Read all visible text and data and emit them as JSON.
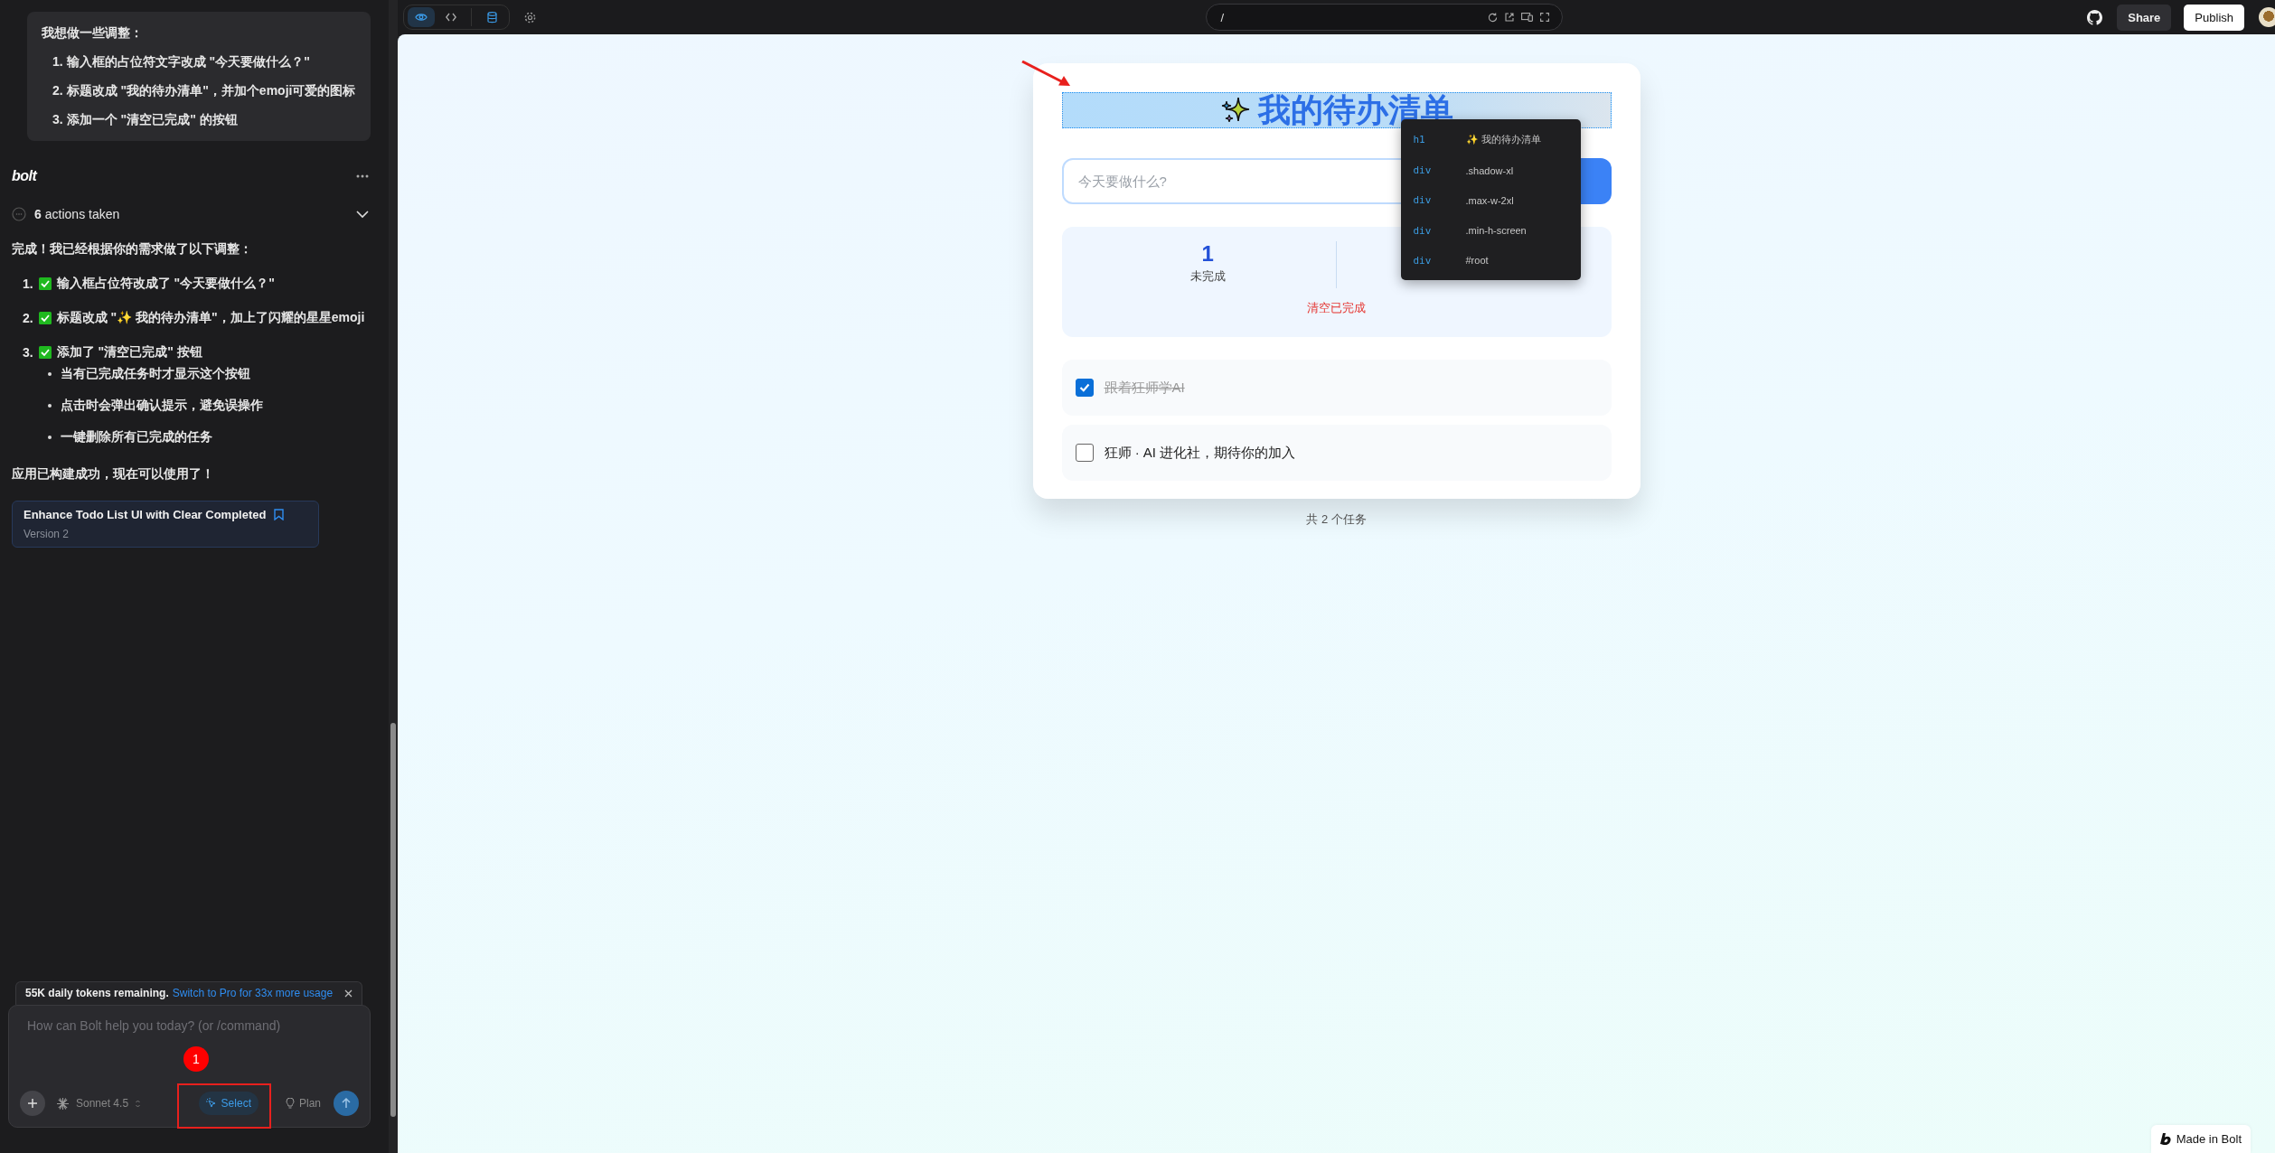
{
  "chat": {
    "user_message": {
      "intro": "我想做一些调整：",
      "items": [
        {
          "number": "1.",
          "text": "输入框的占位符文字改成 \"今天要做什么？\""
        },
        {
          "number": "2.",
          "text": "标题改成 \"我的待办清单\"，并加个emoji可爱的图标"
        },
        {
          "number": "3.",
          "text": "添加一个 \"清空已完成\" 的按钮"
        }
      ]
    },
    "assistant": {
      "name": "bolt",
      "actions": {
        "count": "6",
        "label": "actions taken",
        "expanded": false
      },
      "intro": "完成！我已经根据你的需求做了以下调整：",
      "items": [
        {
          "number": "1.",
          "text": "输入框占位符改成了 \"今天要做什么？\""
        },
        {
          "number": "2.",
          "text": "标题改成 \"✨ 我的待办清单\"，加上了闪耀的星星emoji"
        },
        {
          "number": "3.",
          "text": "添加了 \"清空已完成\" 按钮",
          "children": [
            "当有已完成任务时才显示这个按钮",
            "点击时会弹出确认提示，避免误操作",
            "一键删除所有已完成的任务"
          ]
        }
      ],
      "outro": "应用已构建成功，现在可以使用了！"
    },
    "artifact": {
      "title": "Enhance Todo List UI with Clear Completed",
      "version": "Version 2"
    }
  },
  "prompt": {
    "notice": "55K daily tokens remaining.",
    "notice_link": "Switch to Pro for 33x more usage",
    "placeholder": "How can Bolt help you today? (or /command)",
    "model": "Sonnet 4.5",
    "select": {
      "label": "Select",
      "selected": true
    },
    "plan": "Plan"
  },
  "toolbar": {
    "views": [
      {
        "kind": "preview",
        "selected": true
      },
      {
        "kind": "code",
        "selected": false
      },
      {
        "kind": "database",
        "selected": false
      }
    ],
    "url": "/",
    "share": "Share",
    "publish": "Publish"
  },
  "preview": {
    "title": "我的待办清单",
    "placeholder": "今天要做什么?",
    "stats": [
      {
        "count": "1",
        "label": "未完成"
      }
    ],
    "clear_button": "清空已完成",
    "todos": [
      {
        "text": "跟着狂师学AI",
        "done": true
      },
      {
        "text": "狂师 · AI 进化社，期待你的加入",
        "done": false
      }
    ],
    "footer": "共 2 个任务",
    "inspector": [
      {
        "tag": "h1",
        "label": "✨ 我的待办清单"
      },
      {
        "tag": "div",
        "label": ".shadow-xl"
      },
      {
        "tag": "div",
        "label": ".max-w-2xl"
      },
      {
        "tag": "div",
        "label": ".min-h-screen"
      },
      {
        "tag": "div",
        "label": "#root"
      }
    ],
    "badge": "Made in Bolt"
  },
  "annotation": {
    "step": "1"
  }
}
